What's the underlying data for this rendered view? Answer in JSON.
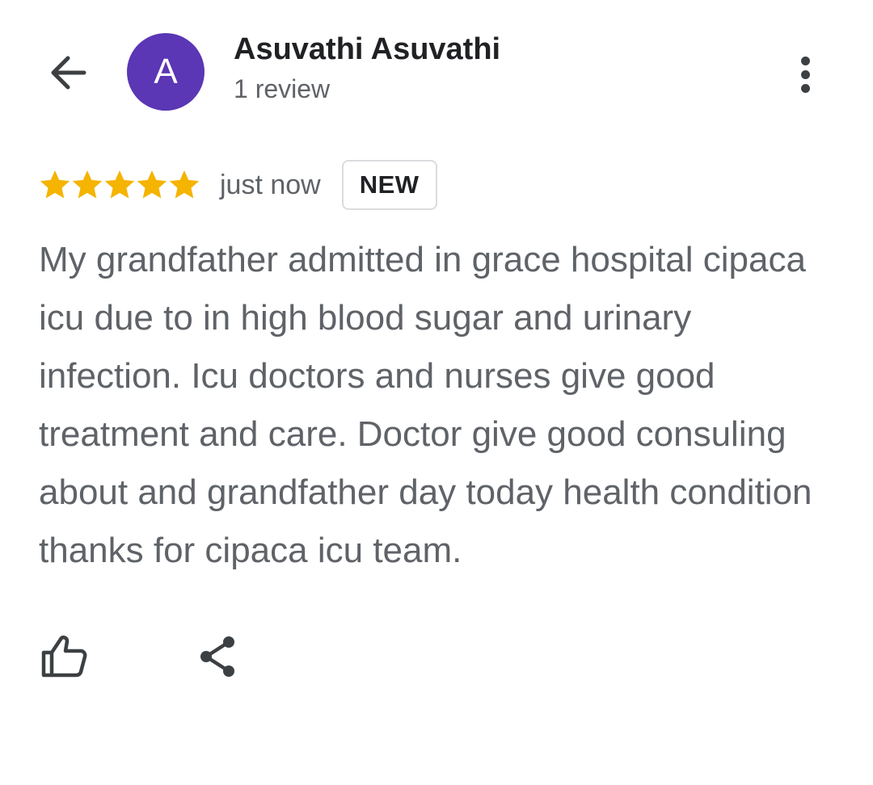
{
  "header": {
    "back_icon": "arrow-left-icon",
    "avatar_letter": "A",
    "avatar_color": "#5b36b5",
    "profile_name": "Asuvathi Asuvathi",
    "review_count": "1 review",
    "more_icon": "more-vertical-icon"
  },
  "review": {
    "rating": 5,
    "max_rating": 5,
    "star_color": "#f4b400",
    "time": "just now",
    "badge": "NEW",
    "text": "My grandfather admitted in grace hospital cipaca icu due to in high blood sugar and urinary infection. Icu doctors and nurses give good treatment and care. Doctor give good consuling about and grandfather day today health condition thanks for cipaca icu team."
  },
  "actions": {
    "like_icon": "thumbs-up-icon",
    "share_icon": "share-icon"
  }
}
